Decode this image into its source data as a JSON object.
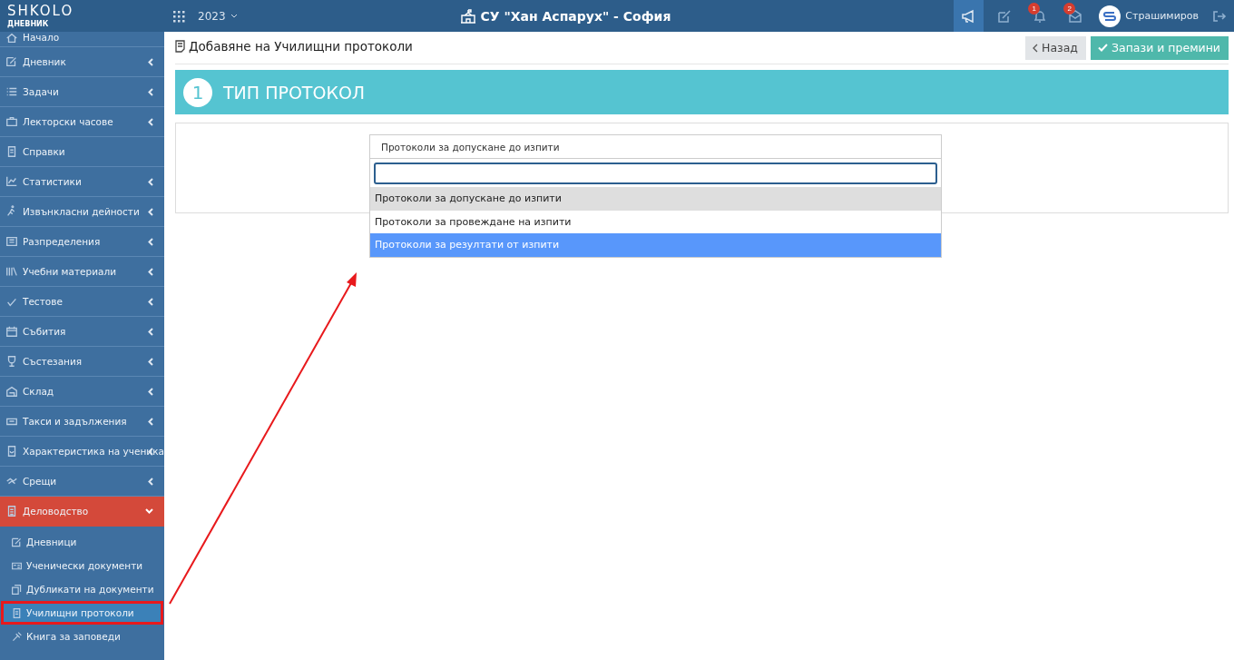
{
  "header": {
    "logo": "SHKOLO",
    "logo_subtitle": "ДНЕВНИК",
    "year": "2023",
    "school": "СУ \"Хан Аспарух\" - София",
    "notifications": "1",
    "messages": "2",
    "user": "Страшимиров"
  },
  "sidebar": {
    "items": [
      {
        "label": "Начало",
        "kind": "link",
        "selected": false
      },
      {
        "label": "Дневник",
        "kind": "group",
        "expanded": false,
        "selected": false
      },
      {
        "label": "Задачи",
        "kind": "group",
        "expanded": false,
        "selected": false
      },
      {
        "label": "Лекторски часове",
        "kind": "group",
        "expanded": false,
        "selected": false
      },
      {
        "label": "Справки",
        "kind": "link",
        "selected": false
      },
      {
        "label": "Статистики",
        "kind": "group",
        "expanded": false,
        "selected": false
      },
      {
        "label": "Извънкласни дейности",
        "kind": "group",
        "expanded": false,
        "selected": false
      },
      {
        "label": "Разпределения",
        "kind": "group",
        "expanded": false,
        "selected": false
      },
      {
        "label": "Учебни материали",
        "kind": "group",
        "expanded": false,
        "selected": false
      },
      {
        "label": "Тестове",
        "kind": "group",
        "expanded": false,
        "selected": false
      },
      {
        "label": "Събития",
        "kind": "group",
        "expanded": false,
        "selected": false
      },
      {
        "label": "Състезания",
        "kind": "group",
        "expanded": false,
        "selected": false
      },
      {
        "label": "Склад",
        "kind": "group",
        "expanded": false,
        "selected": false
      },
      {
        "label": "Такси и задължения",
        "kind": "group",
        "expanded": false,
        "selected": false
      },
      {
        "label": "Характеристика на ученика",
        "kind": "group",
        "expanded": false,
        "selected": false
      },
      {
        "label": "Срещи",
        "kind": "group",
        "expanded": false,
        "selected": false
      },
      {
        "label": "Деловодство",
        "kind": "group",
        "expanded": true,
        "selected": true,
        "children": [
          {
            "label": "Дневници",
            "selected": false,
            "annotated": false
          },
          {
            "label": "Ученически документи",
            "selected": false,
            "annotated": false
          },
          {
            "label": "Дубликати на документи",
            "selected": false,
            "annotated": false
          },
          {
            "label": "Училищни протоколи",
            "selected": true,
            "annotated": true
          },
          {
            "label": "Книга за заповеди",
            "selected": false,
            "annotated": false
          }
        ]
      }
    ]
  },
  "page": {
    "title": "Добавяне на Училищни протоколи",
    "back_button": "Назад",
    "save_button": "Запази и премини"
  },
  "step": {
    "number": "1",
    "title": "ТИП ПРОТОКОЛ"
  },
  "select": {
    "value": "Протоколи за допускане до изпити",
    "options": [
      {
        "label": "Протоколи за допускане до изпити",
        "selected": true,
        "highlighted": false
      },
      {
        "label": "Протоколи за провеждане на изпити",
        "selected": false,
        "highlighted": false
      },
      {
        "label": "Протоколи за резултати от изпити",
        "selected": false,
        "highlighted": true
      }
    ]
  }
}
